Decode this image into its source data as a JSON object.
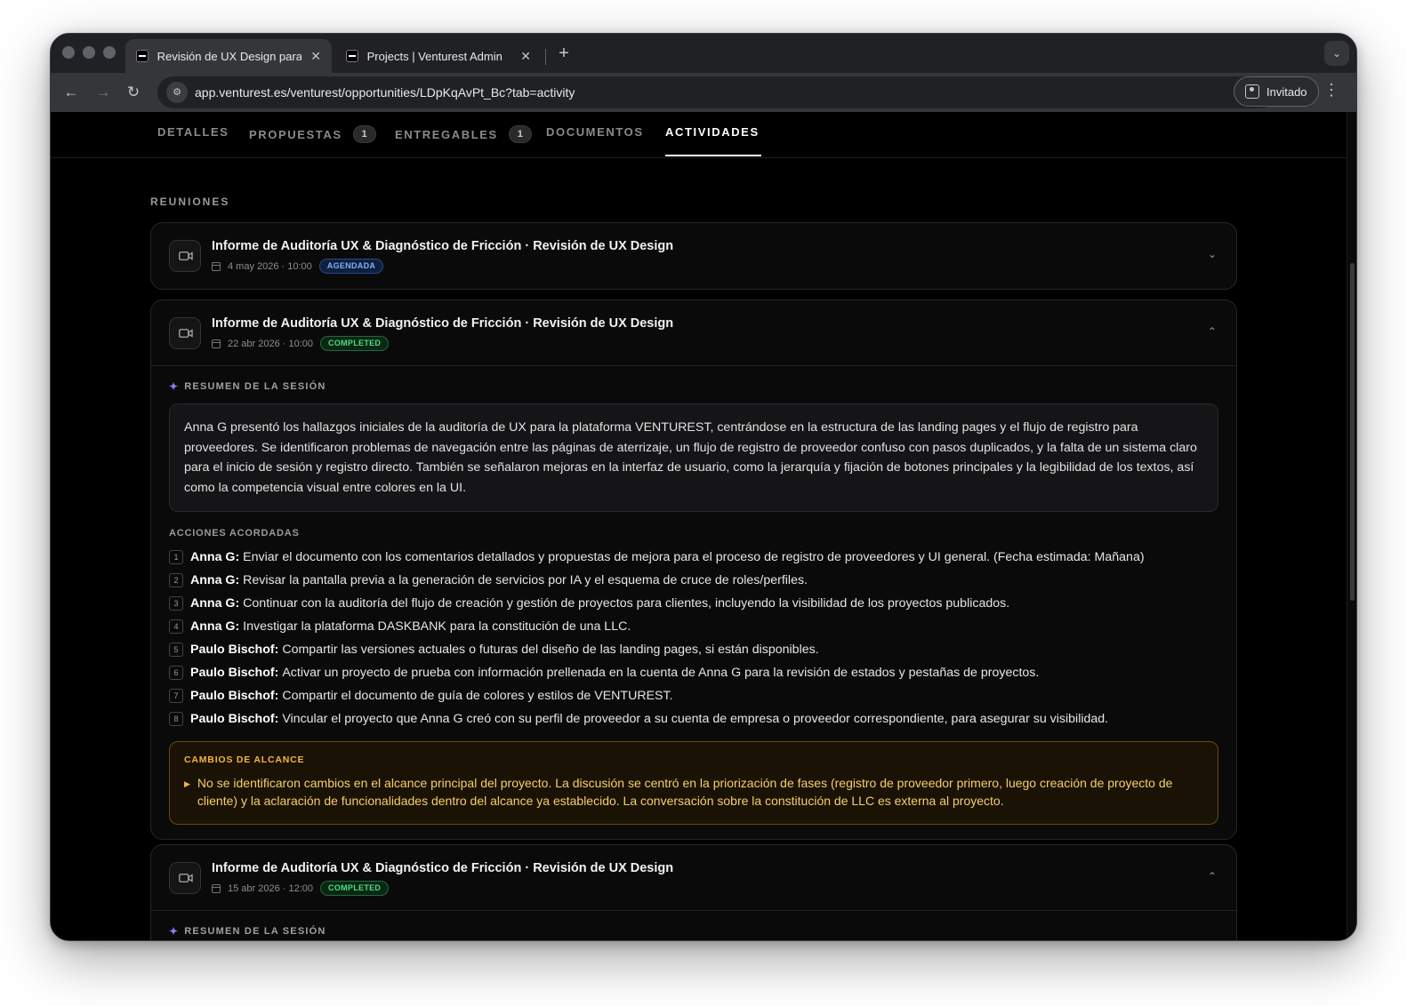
{
  "browser": {
    "tabs": [
      {
        "title": "Revisión de UX Design para V",
        "close": "✕"
      },
      {
        "title": "Projects | Venturest Admin",
        "close": "✕"
      }
    ],
    "new_tab": "+",
    "url": "app.venturest.es/venturest/opportunities/LDpKqAvPt_Bc?tab=activity",
    "profile": "Invitado"
  },
  "subnav": {
    "tabs": [
      {
        "label": "DETALLES"
      },
      {
        "label": "PROPUESTAS",
        "count": "1"
      },
      {
        "label": "ENTREGABLES",
        "count": "1"
      },
      {
        "label": "DOCUMENTOS"
      },
      {
        "label": "ACTIVIDADES",
        "active": true
      }
    ]
  },
  "section": {
    "title": "REUNIONES"
  },
  "meetings": [
    {
      "title": "Informe de Auditoría UX & Diagnóstico de Fricción · Revisión de UX Design",
      "date": "4 may 2026 · 10:00",
      "status": "AGENDADA",
      "status_color": "#7eb0ff"
    },
    {
      "title": "Informe de Auditoría UX & Diagnóstico de Fricción · Revisión de UX Design",
      "date": "22 abr 2026 · 10:00",
      "status": "COMPLETED",
      "status_color": "#4ade80",
      "summary_label": "RESUMEN DE LA SESIÓN",
      "summary": "Anna G presentó los hallazgos iniciales de la auditoría de UX para la plataforma VENTUREST, centrándose en la estructura de las landing pages y el flujo de registro para proveedores. Se identificaron problemas de navegación entre las páginas de aterrizaje, un flujo de registro de proveedor confuso con pasos duplicados, y la falta de un sistema claro para el inicio de sesión y registro directo. También se señalaron mejoras en la interfaz de usuario, como la jerarquía y fijación de botones principales y la legibilidad de los textos, así como la competencia visual entre colores en la UI.",
      "actions_label": "ACCIONES ACORDADAS",
      "actions": [
        {
          "n": "1",
          "owner": "Anna G:",
          "text": "Enviar el documento con los comentarios detallados y propuestas de mejora para el proceso de registro de proveedores y UI general. (Fecha estimada: Mañana)"
        },
        {
          "n": "2",
          "owner": "Anna G:",
          "text": "Revisar la pantalla previa a la generación de servicios por IA y el esquema de cruce de roles/perfiles."
        },
        {
          "n": "3",
          "owner": "Anna G:",
          "text": "Continuar con la auditoría del flujo de creación y gestión de proyectos para clientes, incluyendo la visibilidad de los proyectos publicados."
        },
        {
          "n": "4",
          "owner": "Anna G:",
          "text": "Investigar la plataforma DASKBANK para la constitución de una LLC."
        },
        {
          "n": "5",
          "owner": "Paulo Bischof:",
          "text": "Compartir las versiones actuales o futuras del diseño de las landing pages, si están disponibles."
        },
        {
          "n": "6",
          "owner": "Paulo Bischof:",
          "text": "Activar un proyecto de prueba con información prellenada en la cuenta de Anna G para la revisión de estados y pestañas de proyectos."
        },
        {
          "n": "7",
          "owner": "Paulo Bischof:",
          "text": "Compartir el documento de guía de colores y estilos de VENTUREST."
        },
        {
          "n": "8",
          "owner": "Paulo Bischof:",
          "text": "Vincular el proyecto que Anna G creó con su perfil de proveedor a su cuenta de empresa o proveedor correspondiente, para asegurar su visibilidad."
        }
      ],
      "scope_label": "CAMBIOS DE ALCANCE",
      "scope_text": "No se identificaron cambios en el alcance principal del proyecto. La discusión se centró en la priorización de fases (registro de proveedor primero, luego creación de proyecto de cliente) y la aclaración de funcionalidades dentro del alcance ya establecido. La conversación sobre la constitución de LLC es externa al proyecto."
    },
    {
      "title": "Informe de Auditoría UX & Diagnóstico de Fricción · Revisión de UX Design",
      "date": "15 abr 2026 · 12:00",
      "status": "COMPLETED",
      "status_color": "#4ade80",
      "summary_label": "RESUMEN DE LA SESIÓN"
    }
  ]
}
